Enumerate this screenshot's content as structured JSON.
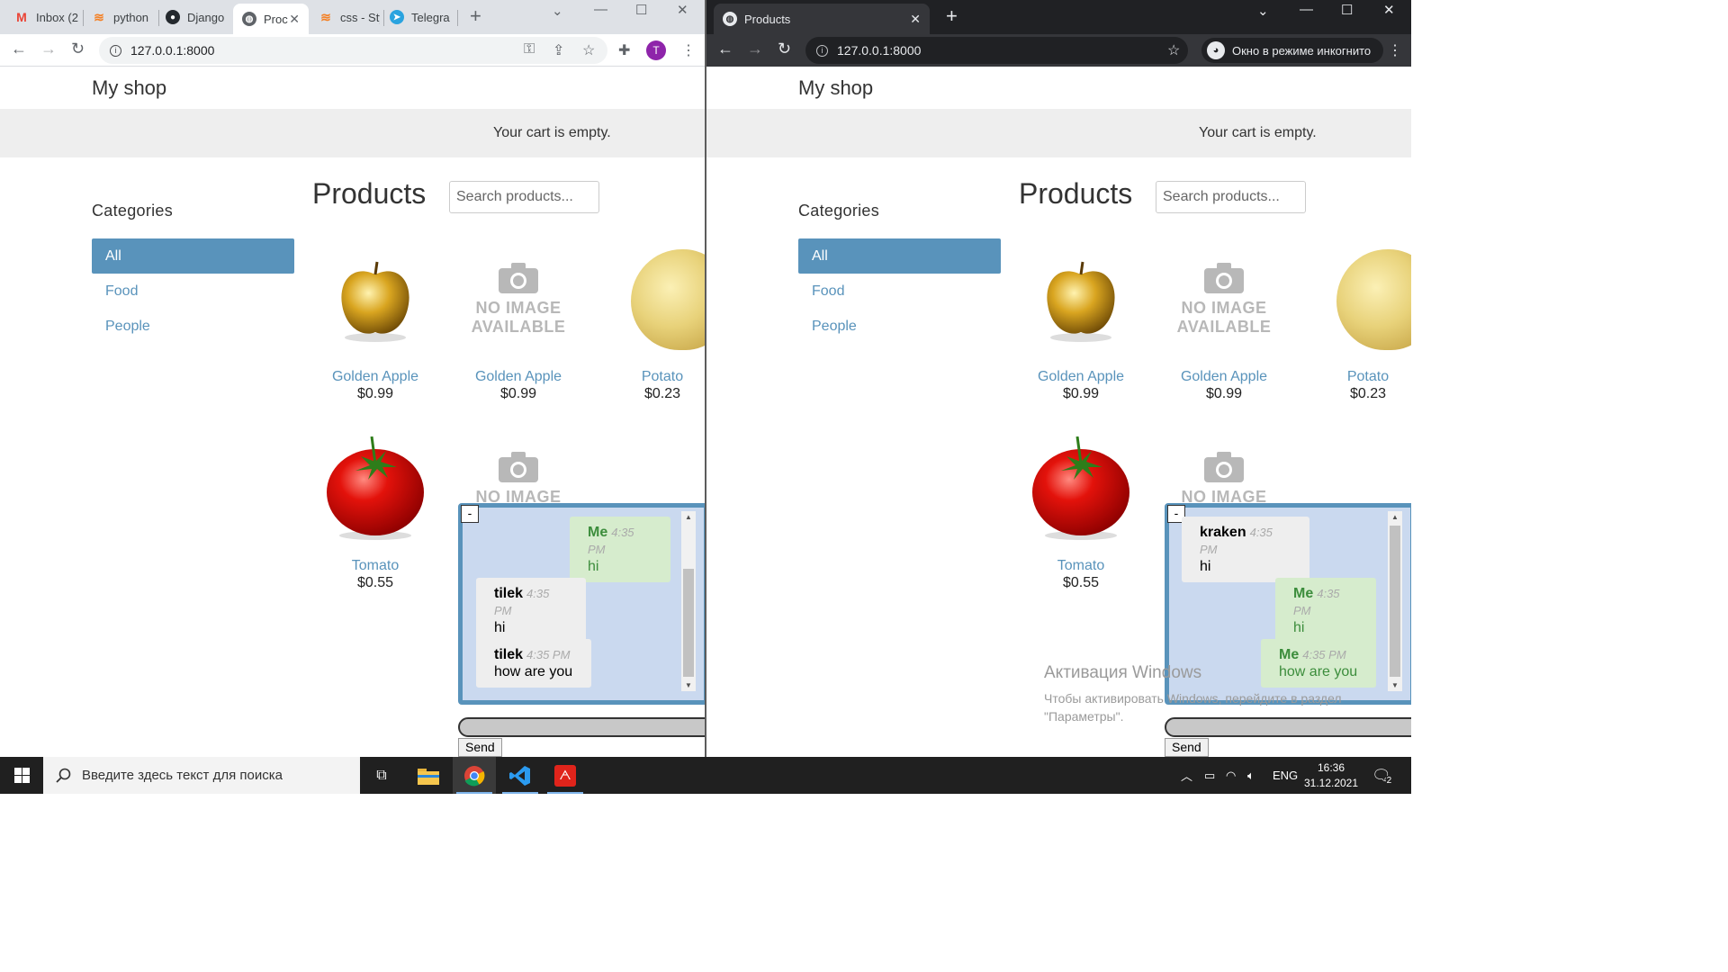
{
  "left_window": {
    "tabs": [
      {
        "label": "Inbox (2",
        "icon": "gmail-icon",
        "color": "#ea4335"
      },
      {
        "label": "python",
        "icon": "stackoverflow-icon",
        "color": "#f48024"
      },
      {
        "label": "Django",
        "icon": "github-icon",
        "color": "#24292e"
      },
      {
        "label": "Proc",
        "icon": "globe-icon",
        "color": "#5f6368",
        "active": true
      },
      {
        "label": "css - Sty",
        "icon": "stackoverflow-icon",
        "color": "#f48024"
      },
      {
        "label": "Telegra",
        "icon": "telegram-icon",
        "color": "#2aa3df"
      }
    ],
    "url": "127.0.0.1:8000",
    "profile_initial": "T",
    "chat": {
      "messages": [
        {
          "who": "Me",
          "time": "4:35 PM",
          "text": "hi",
          "mine": true
        },
        {
          "who": "tilek",
          "time": "4:35 PM",
          "text": "hi",
          "mine": false
        },
        {
          "who": "tilek",
          "time": "4:35 PM",
          "text": "how are you",
          "mine": false
        }
      ]
    }
  },
  "right_window": {
    "tab_label": "Products",
    "url": "127.0.0.1:8000",
    "incognito_label": "Окно в режиме инкогнито",
    "chat": {
      "messages": [
        {
          "who": "kraken",
          "time": "4:35 PM",
          "text": "hi",
          "mine": false
        },
        {
          "who": "Me",
          "time": "4:35 PM",
          "text": "hi",
          "mine": true
        },
        {
          "who": "Me",
          "time": "4:35 PM",
          "text": "how are you",
          "mine": true
        }
      ]
    },
    "watermark_title": "Активация Windows",
    "watermark_text_1": "Чтобы активировать Windows, перейдите в раздел",
    "watermark_text_2": "\"Параметры\"."
  },
  "shop": {
    "brand": "My shop",
    "cart_text": "Your cart is empty.",
    "categories_title": "Categories",
    "categories": [
      "All",
      "Food",
      "People"
    ],
    "products_title": "Products",
    "search_placeholder": "Search products...",
    "products": [
      {
        "name": "Golden Apple",
        "price": "$0.99",
        "image": "golden-apple"
      },
      {
        "name": "Golden Apple",
        "price": "$0.99",
        "image": "no-image"
      },
      {
        "name": "Potato",
        "price": "$0.23",
        "image": "potato"
      },
      {
        "name": "Tomato",
        "price": "$0.55",
        "image": "tomato"
      },
      {
        "name": "",
        "price": "",
        "image": "no-image"
      }
    ],
    "no_image_line1": "NO IMAGE",
    "no_image_line2": "AVAILABLE",
    "minimize_label": "-",
    "send_label": "Send"
  },
  "taskbar": {
    "search_placeholder": "Введите здесь текст для поиска",
    "language": "ENG",
    "time": "16:36",
    "date": "31.12.2021",
    "notification_count": "2"
  },
  "colors": {
    "link": "#5993bb",
    "chat_border": "#5993bb",
    "chat_bg": "#cad9ef",
    "me_text": "#3c8d3c"
  }
}
